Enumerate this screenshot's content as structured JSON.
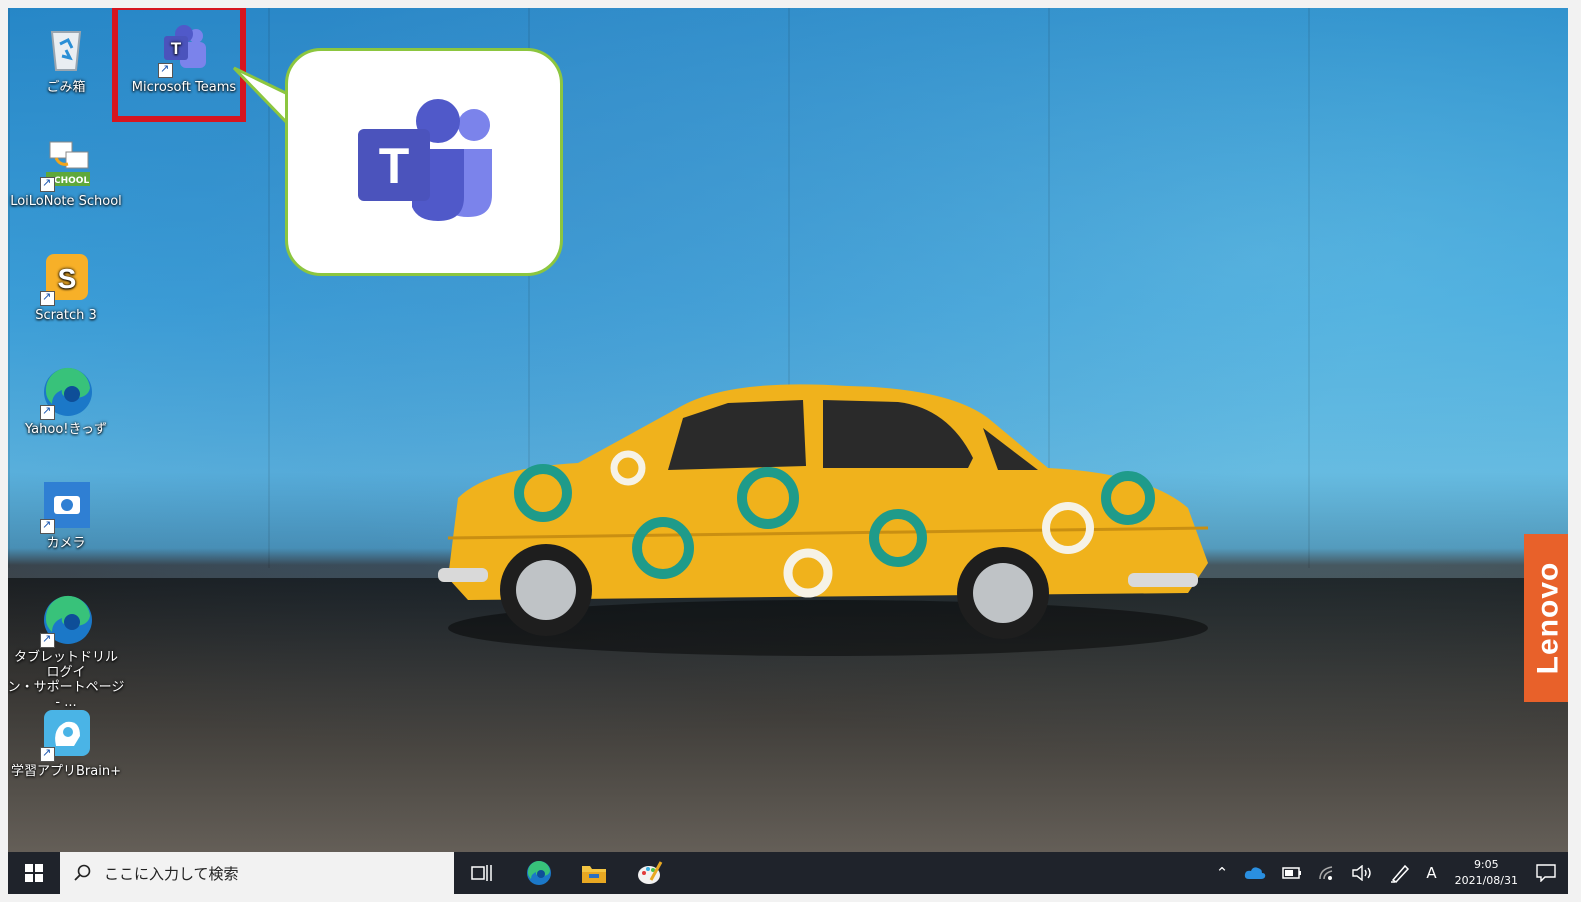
{
  "desktop": {
    "icons": [
      {
        "label": "ごみ箱",
        "icon": "recycle-bin-icon"
      },
      {
        "label": "Microsoft Teams",
        "icon": "teams-icon"
      },
      {
        "label": "LoiLoNote School",
        "icon": "loilonote-icon"
      },
      {
        "label": "Scratch 3",
        "icon": "scratch-icon"
      },
      {
        "label": "Yahoo!きっず",
        "icon": "edge-icon"
      },
      {
        "label": "カメラ",
        "icon": "camera-icon"
      },
      {
        "label_line1": "タブレットドリル ログイ",
        "label_line2": "ン・サポートページ - ...",
        "icon": "edge-icon"
      },
      {
        "label": "学習アプリBrain+",
        "icon": "brain-plus-icon"
      }
    ],
    "brand_label": "Lenovo",
    "loilonote_badge": "CHOOL"
  },
  "callout": {
    "icon": "teams-icon",
    "border_color": "#8cc63f"
  },
  "highlight": {
    "color": "#d6151f"
  },
  "taskbar": {
    "search_placeholder": "ここに入力して検索",
    "apps": [
      "task-view-icon",
      "edge-icon",
      "file-explorer-icon",
      "paint-icon"
    ],
    "tray": {
      "ime_mode": "A",
      "time": "9:05",
      "date": "2021/08/31"
    }
  },
  "colors": {
    "taskbar": "#1f232b",
    "lenovo": "#e8612a",
    "teams_dark": "#4b53bc",
    "teams_light": "#7b83eb"
  }
}
